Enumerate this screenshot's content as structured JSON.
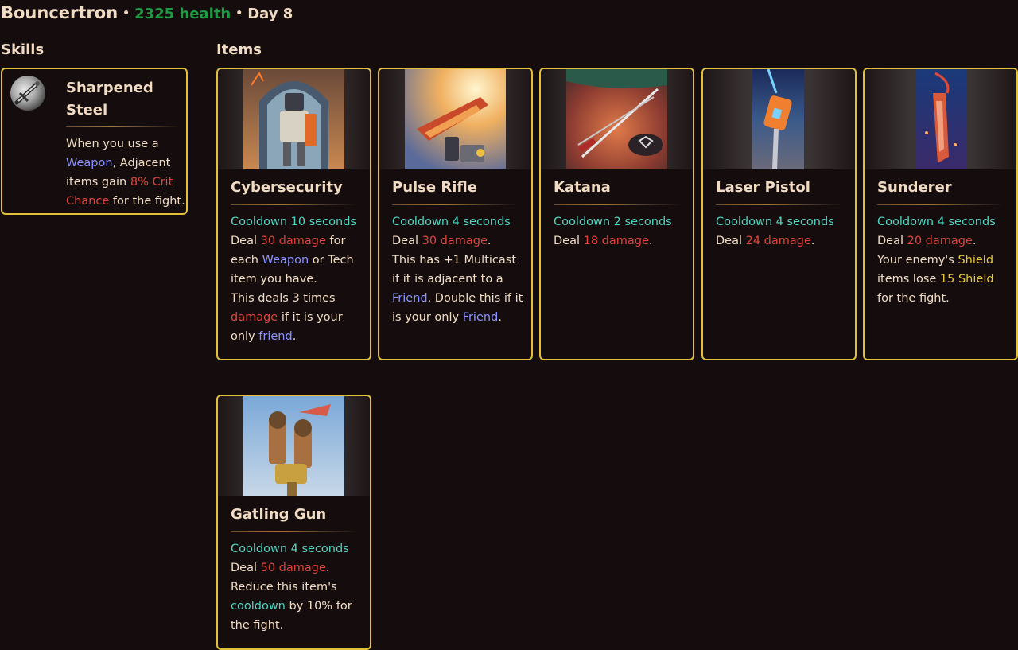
{
  "header": {
    "name": "Bouncertron",
    "sep1": "•",
    "health": "2325 health",
    "sep2": "•",
    "day": "Day 8"
  },
  "sections": {
    "skills": "Skills",
    "items": "Items"
  },
  "skill": {
    "title_line1": "Sharpened",
    "title_line2": "Steel",
    "desc": {
      "t1": "When you use a ",
      "k1": "Weapon",
      "t2": ", Adjacent items gain ",
      "k2": "8% Crit Chance",
      "t3": " for the fight."
    },
    "icon": "sword-skill-icon"
  },
  "items": [
    {
      "title": "Cybersecurity",
      "cooldown": "Cooldown 10 seconds",
      "p": {
        "a": "Deal ",
        "dmg": "30 damage",
        "b": " for each ",
        "weapon": "Weapon",
        "c": " or Tech item you have.",
        "d": "This deals 3 times ",
        "dmg2": "damage",
        "e": " if it is your only ",
        "friend": "friend",
        "f": "."
      }
    },
    {
      "title": "Pulse Rifle",
      "cooldown": "Cooldown 4 seconds",
      "p": {
        "a": "Deal ",
        "dmg": "30 damage",
        "b": ".",
        "c": "This has +1 Multicast if it is adjacent to a ",
        "friend": "Friend",
        "d": ". Double this if it is your only ",
        "friend2": "Friend",
        "e": "."
      }
    },
    {
      "title": "Katana",
      "cooldown": "Cooldown 2 seconds",
      "p": {
        "a": "Deal ",
        "dmg": "18 damage",
        "b": "."
      }
    },
    {
      "title": "Laser Pistol",
      "cooldown": "Cooldown 4 seconds",
      "p": {
        "a": "Deal ",
        "dmg": "24 damage",
        "b": "."
      }
    },
    {
      "title": "Sunderer",
      "cooldown": "Cooldown 4 seconds",
      "p": {
        "a": "Deal ",
        "dmg": "20 damage",
        "b": ".",
        "c": "Your enemy's ",
        "shield": "Shield",
        "d": " items lose ",
        "shield2": "15 Shield",
        "e": " for the fight."
      }
    },
    {
      "title": "Gatling Gun",
      "cooldown": "Cooldown 4 seconds",
      "p": {
        "a": "Deal ",
        "dmg": "50 damage",
        "b": ".",
        "c": "Reduce this item's ",
        "cool": "cooldown",
        "d": " by 10% for the fight."
      }
    }
  ],
  "colors": {
    "background": "#150d0d",
    "border": "#e3c03a",
    "health": "#1f9a45",
    "cooldown": "#4fd6c2",
    "damage": "#e0453c",
    "keyword": "#8c94ff",
    "shield": "#e8c83a"
  }
}
